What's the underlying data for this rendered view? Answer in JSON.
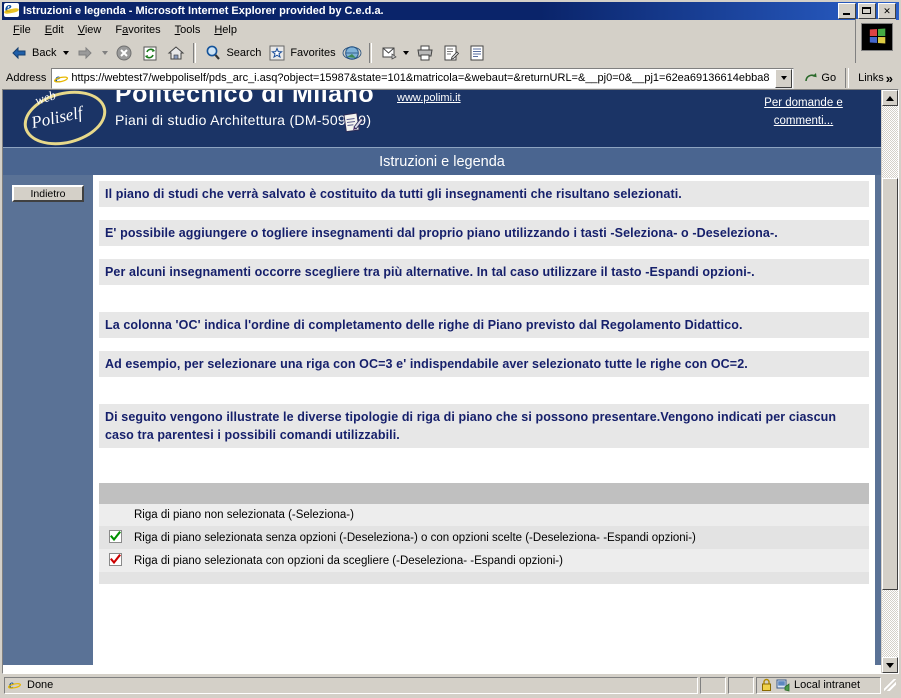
{
  "window": {
    "title": "Istruzioni e legenda - Microsoft Internet Explorer provided by C.e.d.a.",
    "icon": "ie-icon",
    "minimize_label": "",
    "maximize_label": "",
    "close_label": "✕"
  },
  "menubar": {
    "items": [
      {
        "label": "File",
        "accel": "F"
      },
      {
        "label": "Edit",
        "accel": "E"
      },
      {
        "label": "View",
        "accel": "V"
      },
      {
        "label": "Favorites",
        "accel": "a"
      },
      {
        "label": "Tools",
        "accel": "T"
      },
      {
        "label": "Help",
        "accel": "H"
      }
    ]
  },
  "toolbar": {
    "back_label": "Back",
    "forward_label": "",
    "stop_label": "",
    "refresh_label": "",
    "home_label": "",
    "search_label": "Search",
    "favorites_label": "Favorites",
    "media_label": "",
    "mail_label": "",
    "print_label": "",
    "edit_label": "",
    "discuss_label": ""
  },
  "address": {
    "label": "Address",
    "value": "https://webtest7/webpoliself/pds_arc_i.asq?object=15987&state=101&matricola=&webaut=&returnURL=&__pj0=0&__pj1=62ea69136614ebba8",
    "go_label": "Go",
    "links_label": "Links",
    "links_chevron": "»"
  },
  "page": {
    "header": {
      "logo_word_top": "web",
      "logo_word_main": "Poliself",
      "institution": "Politecnico di Milano",
      "institution_url": "www.polimi.it",
      "subtitle": "Piani di studio Architettura (DM-509/99)",
      "contact_link": "Per domande e commenti..."
    },
    "banner_title": "Istruzioni e legenda",
    "back_button": "Indietro",
    "paragraphs": [
      "Il piano di studi che verrà salvato è costituito da tutti gli insegnamenti che risultano selezionati.",
      "E' possibile aggiungere o togliere insegnamenti dal proprio piano utilizzando i tasti -Seleziona- o -Deseleziona-.",
      "Per alcuni insegnamenti occorre scegliere tra più alternative. In tal caso utilizzare il tasto -Espandi opzioni-.",
      "La colonna 'OC' indica l'ordine di completamento delle righe di Piano previsto dal Regolamento Didattico.",
      "Ad esempio, per selezionare una riga con OC=3 e' indispendabile aver selezionato tutte le righe con OC=2.",
      "Di seguito vengono illustrate le diverse tipologie di riga di piano che si possono presentare.Vengono indicati per ciascun caso tra parentesi i possibili comandi utilizzabili."
    ],
    "legend": {
      "rows": [
        {
          "icon": "none",
          "text": "Riga di piano non selezionata (-Seleziona-)"
        },
        {
          "icon": "check-green",
          "text": "Riga di piano selezionata senza opzioni (-Deseleziona-) o con opzioni scelte (-Deseleziona- -Espandi opzioni-)"
        },
        {
          "icon": "check-red",
          "text": "Riga di piano selezionata con opzioni da scegliere (-Deseleziona- -Espandi opzioni-)"
        }
      ]
    }
  },
  "statusbar": {
    "status": "Done",
    "zone": "Local intranet",
    "security_icon": "lock-icon"
  },
  "colors": {
    "header_blue": "#1b3466",
    "banner_blue": "#4a6590",
    "page_blue": "#5a7296",
    "para_bg": "#e7e7e7",
    "para_text": "#16206b",
    "titlebar": "#0a246a",
    "chrome": "#d4d0c8",
    "check_green": "#009000",
    "check_red": "#cc0000"
  }
}
